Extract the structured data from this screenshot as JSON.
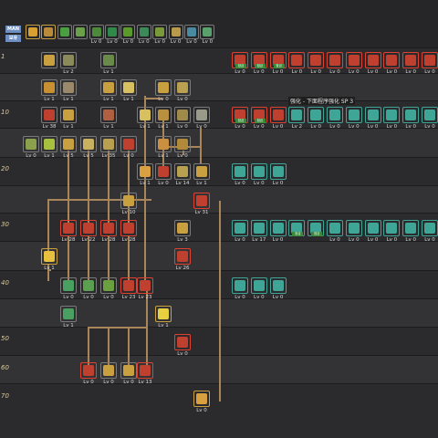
{
  "header": {
    "badges": [
      "MAN",
      "보유"
    ],
    "slots": [
      {
        "color": "#d8a030",
        "border": "gold",
        "tag": "",
        "lv": ""
      },
      {
        "color": "#b88a3a",
        "border": "gold",
        "tag": "",
        "lv": ""
      },
      {
        "color": "#4aa040",
        "border": "gray",
        "tag": "",
        "lv": ""
      },
      {
        "color": "#6aa04a",
        "border": "gray",
        "tag": "",
        "lv": ""
      },
      {
        "color": "#4a8a3a",
        "border": "gray",
        "tag": "",
        "lv": "Lv 0"
      },
      {
        "color": "#2f8a4a",
        "border": "gray",
        "tag": "",
        "lv": "Lv 0"
      },
      {
        "color": "#5a9a2a",
        "border": "gray",
        "tag": "",
        "lv": "Lv 0"
      },
      {
        "color": "#3a8a5a",
        "border": "gray",
        "tag": "",
        "lv": "Lv 0"
      },
      {
        "color": "#7a9a3a",
        "border": "gray",
        "tag": "",
        "lv": "Lv 0"
      },
      {
        "color": "#b89a4a",
        "border": "gray",
        "tag": "",
        "lv": "Lv 0"
      },
      {
        "color": "#4a8aa0",
        "border": "gray",
        "tag": "",
        "lv": "Lv 0"
      },
      {
        "color": "#5aa06a",
        "border": "gray",
        "tag": "",
        "lv": "Lv 0"
      }
    ]
  },
  "levels": [
    "1",
    "10",
    "20",
    "30",
    "40",
    "50",
    "60",
    "70"
  ],
  "tooltip": "强化 - 下面程序强化 SP 3",
  "skills": [
    {
      "col": 1,
      "row": 1,
      "color": "#c8a040",
      "border": "gray",
      "lv": ""
    },
    {
      "col": 2,
      "row": 1,
      "color": "#8a8a5a",
      "border": "gray",
      "lv": "Lv 2"
    },
    {
      "col": 4,
      "row": 1,
      "color": "#6a8a4a",
      "border": "gray",
      "lv": "Lv 1"
    },
    {
      "col": 1,
      "row": 2,
      "color": "#c89030",
      "border": "gray",
      "lv": "Lv 1"
    },
    {
      "col": 2,
      "row": 2,
      "color": "#9a8a6a",
      "border": "gray",
      "lv": "Lv 1"
    },
    {
      "col": 4,
      "row": 2,
      "color": "#c8a040",
      "border": "gray",
      "lv": "Lv 1"
    },
    {
      "col": 5,
      "row": 2,
      "color": "#d8c060",
      "border": "gray",
      "lv": "Lv 1"
    },
    {
      "col": 7,
      "row": 2,
      "color": "#c8a040",
      "border": "gray",
      "lv": "Lv 0"
    },
    {
      "col": 8,
      "row": 2,
      "color": "#b8a050",
      "border": "gray",
      "lv": "Lv 0"
    },
    {
      "col": 1,
      "row": 3,
      "color": "#c04030",
      "border": "gray",
      "lv": "Lv 38"
    },
    {
      "col": 2,
      "row": 3,
      "color": "#c8a040",
      "border": "gray",
      "lv": "Lv 1"
    },
    {
      "col": 4,
      "row": 3,
      "color": "#b06040",
      "border": "gray",
      "lv": "Lv 1"
    },
    {
      "col": 6,
      "row": 3,
      "color": "#d8c060",
      "border": "gray",
      "lv": "Lv 1"
    },
    {
      "col": 7,
      "row": 3,
      "color": "#b89040",
      "border": "gray",
      "lv": "Lv 1"
    },
    {
      "col": 8,
      "row": 3,
      "color": "#a08a4a",
      "border": "gray",
      "lv": "Lv 0"
    },
    {
      "col": 9,
      "row": 3,
      "color": "#9a9a8a",
      "border": "gray",
      "lv": "Lv 0"
    },
    {
      "col": 0,
      "row": 4,
      "color": "#8aa04a",
      "border": "gray",
      "lv": "Lv 0"
    },
    {
      "col": 1,
      "row": 4,
      "color": "#a8c040",
      "border": "gray",
      "lv": "Lv 1"
    },
    {
      "col": 2,
      "row": 4,
      "color": "#c8a040",
      "border": "gray",
      "lv": "Lv 5"
    },
    {
      "col": 3,
      "row": 4,
      "color": "#c8b060",
      "border": "gray",
      "lv": "Lv 5"
    },
    {
      "col": 4,
      "row": 4,
      "color": "#b8a050",
      "border": "gray",
      "lv": "Lv 35"
    },
    {
      "col": 5,
      "row": 4,
      "color": "#c04030",
      "border": "gray",
      "lv": "Lv 0"
    },
    {
      "col": 7,
      "row": 4,
      "color": "#c89040",
      "border": "gray",
      "lv": "Lv 1"
    },
    {
      "col": 8,
      "row": 4,
      "color": "#b08a3a",
      "border": "gray",
      "lv": "Lv 0"
    },
    {
      "col": 6,
      "row": 5,
      "color": "#d8a040",
      "border": "gray",
      "lv": "Lv 1"
    },
    {
      "col": 7,
      "row": 5,
      "color": "#c04030",
      "border": "gray",
      "lv": "Lv 0"
    },
    {
      "col": 8,
      "row": 5,
      "color": "#b8a050",
      "border": "gray",
      "lv": "Lv 14"
    },
    {
      "col": 9,
      "row": 5,
      "color": "#c8a040",
      "border": "gray",
      "lv": "Lv 1"
    },
    {
      "col": 5,
      "row": 6,
      "color": "#c8a040",
      "border": "gray",
      "lv": "Lv 10"
    },
    {
      "col": 9,
      "row": 6,
      "color": "#c04030",
      "border": "red",
      "lv": "Lv 31"
    },
    {
      "col": 2,
      "row": 7,
      "color": "#c04030",
      "border": "red",
      "lv": "Lv 28"
    },
    {
      "col": 3,
      "row": 7,
      "color": "#c04030",
      "border": "red",
      "lv": "Lv 22"
    },
    {
      "col": 4,
      "row": 7,
      "color": "#c04030",
      "border": "red",
      "lv": "Lv 28"
    },
    {
      "col": 5,
      "row": 7,
      "color": "#c04030",
      "border": "red",
      "lv": "Lv 28"
    },
    {
      "col": 8,
      "row": 7,
      "color": "#c8a040",
      "border": "gray",
      "lv": "Lv 3"
    },
    {
      "col": 1,
      "row": 8,
      "color": "#e8c040",
      "border": "gold",
      "lv": "Lv 1"
    },
    {
      "col": 8,
      "row": 8,
      "color": "#c04030",
      "border": "red",
      "lv": "Lv 26"
    },
    {
      "col": 2,
      "row": 9,
      "color": "#4aa060",
      "border": "gray",
      "lv": "Lv 0"
    },
    {
      "col": 3,
      "row": 9,
      "color": "#5aa050",
      "border": "gray",
      "lv": "Lv 0"
    },
    {
      "col": 4,
      "row": 9,
      "color": "#6aa040",
      "border": "gray",
      "lv": "Lv 0"
    },
    {
      "col": 5,
      "row": 9,
      "color": "#c04030",
      "border": "red",
      "lv": "Lv 23"
    },
    {
      "col": 6,
      "row": 9,
      "color": "#c04030",
      "border": "red",
      "lv": "Lv 23"
    },
    {
      "col": 2,
      "row": 10,
      "color": "#4aa060",
      "border": "gray",
      "lv": "Lv 1"
    },
    {
      "col": 7,
      "row": 10,
      "color": "#e8d040",
      "border": "gold",
      "lv": "Lv 1"
    },
    {
      "col": 8,
      "row": 11,
      "color": "#c04030",
      "border": "red",
      "lv": "Lv 0"
    },
    {
      "col": 3,
      "row": 12,
      "color": "#c04030",
      "border": "red",
      "lv": "Lv 0"
    },
    {
      "col": 4,
      "row": 12,
      "color": "#c8a040",
      "border": "gray",
      "lv": "Lv 0"
    },
    {
      "col": 5,
      "row": 12,
      "color": "#c8a040",
      "border": "gray",
      "lv": "Lv 0"
    },
    {
      "col": 6,
      "row": 12,
      "color": "#c04030",
      "border": "red",
      "lv": "Lv 13"
    },
    {
      "col": 9,
      "row": 13,
      "color": "#d8a040",
      "border": "gold",
      "lv": "Lv 0"
    }
  ],
  "right_groups": [
    {
      "row": 1,
      "slots": [
        {
          "color": "#c04030",
          "border": "red",
          "tag": "잠금",
          "lv": "Lv 0"
        },
        {
          "color": "#c04030",
          "border": "red",
          "tag": "잠금",
          "lv": "Lv 0"
        },
        {
          "color": "#c04030",
          "border": "red",
          "tag": "잠금",
          "lv": "Lv 0"
        },
        {
          "color": "#c04030",
          "border": "red",
          "tag": "",
          "lv": "Lv 0"
        },
        {
          "color": "#c04030",
          "border": "red",
          "tag": "",
          "lv": "Lv 0"
        },
        {
          "color": "#c04030",
          "border": "red",
          "tag": "",
          "lv": "Lv 0"
        },
        {
          "color": "#c04030",
          "border": "red",
          "tag": "",
          "lv": "Lv 0"
        },
        {
          "color": "#c04030",
          "border": "red",
          "tag": "",
          "lv": "Lv 0"
        },
        {
          "color": "#c04030",
          "border": "red",
          "tag": "",
          "lv": "Lv 0"
        },
        {
          "color": "#c04030",
          "border": "red",
          "tag": "",
          "lv": "Lv 0"
        },
        {
          "color": "#c04030",
          "border": "red",
          "tag": "",
          "lv": "Lv 0"
        }
      ]
    },
    {
      "row": 3,
      "slots": [
        {
          "color": "#c04030",
          "border": "red",
          "tag": "잠금",
          "lv": "Lv 0"
        },
        {
          "color": "#c04030",
          "border": "red",
          "tag": "잠금",
          "lv": "Lv 0"
        },
        {
          "color": "#c04030",
          "border": "red",
          "tag": "",
          "lv": "Lv 0"
        },
        {
          "color": "#3fa596",
          "border": "teal",
          "tag": "",
          "lv": "Lv 2"
        },
        {
          "color": "#3fa596",
          "border": "teal",
          "tag": "",
          "lv": "Lv 0"
        },
        {
          "color": "#3fa596",
          "border": "teal",
          "tag": "",
          "lv": "Lv 0"
        },
        {
          "color": "#3fa596",
          "border": "teal",
          "tag": "",
          "lv": "Lv 0"
        },
        {
          "color": "#3fa596",
          "border": "teal",
          "tag": "",
          "lv": "Lv 0"
        },
        {
          "color": "#3fa596",
          "border": "teal",
          "tag": "",
          "lv": "Lv 0"
        },
        {
          "color": "#3fa596",
          "border": "teal",
          "tag": "",
          "lv": "Lv 0"
        },
        {
          "color": "#3fa596",
          "border": "teal",
          "tag": "",
          "lv": "Lv 0"
        }
      ]
    },
    {
      "row": 5,
      "slots": [
        {
          "color": "#3fa596",
          "border": "teal",
          "tag": "",
          "lv": "Lv 0"
        },
        {
          "color": "#3fa596",
          "border": "teal",
          "tag": "",
          "lv": "Lv 0"
        },
        {
          "color": "#3fa596",
          "border": "teal",
          "tag": "",
          "lv": "Lv 0"
        }
      ]
    },
    {
      "row": 7,
      "slots": [
        {
          "color": "#3fa596",
          "border": "teal",
          "tag": "",
          "lv": "Lv 0"
        },
        {
          "color": "#3fa596",
          "border": "teal",
          "tag": "",
          "lv": "Lv 17"
        },
        {
          "color": "#3fa596",
          "border": "teal",
          "tag": "",
          "lv": "Lv 0"
        },
        {
          "color": "#3fa596",
          "border": "teal",
          "tag": "잠금",
          "lv": ""
        },
        {
          "color": "#3fa596",
          "border": "teal",
          "tag": "잠금",
          "lv": ""
        },
        {
          "color": "#3fa596",
          "border": "teal",
          "tag": "",
          "lv": "Lv 0"
        },
        {
          "color": "#3fa596",
          "border": "teal",
          "tag": "",
          "lv": "Lv 0"
        },
        {
          "color": "#3fa596",
          "border": "teal",
          "tag": "",
          "lv": "Lv 0"
        },
        {
          "color": "#3fa596",
          "border": "teal",
          "tag": "",
          "lv": "Lv 0"
        },
        {
          "color": "#3fa596",
          "border": "teal",
          "tag": "",
          "lv": "Lv 0"
        },
        {
          "color": "#3fa596",
          "border": "teal",
          "tag": "",
          "lv": "Lv 0"
        }
      ]
    },
    {
      "row": 9,
      "slots": [
        {
          "color": "#3fa596",
          "border": "teal",
          "tag": "",
          "lv": "Lv 0"
        },
        {
          "color": "#3fa596",
          "border": "teal",
          "tag": "",
          "lv": "Lv 0"
        },
        {
          "color": "#3fa596",
          "border": "teal",
          "tag": "",
          "lv": "Lv 0"
        }
      ]
    }
  ]
}
